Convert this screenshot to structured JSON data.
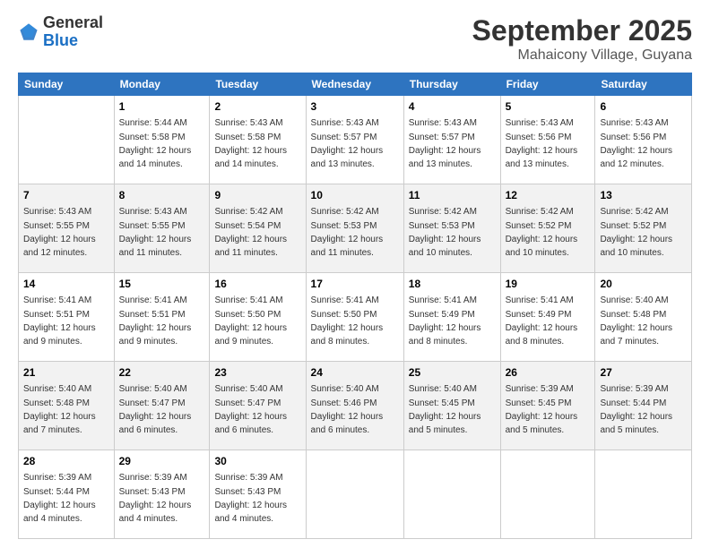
{
  "header": {
    "logo_general": "General",
    "logo_blue": "Blue",
    "month": "September 2025",
    "location": "Mahaicony Village, Guyana"
  },
  "weekdays": [
    "Sunday",
    "Monday",
    "Tuesday",
    "Wednesday",
    "Thursday",
    "Friday",
    "Saturday"
  ],
  "weeks": [
    [
      {
        "day": "",
        "sunrise": "",
        "sunset": "",
        "daylight": ""
      },
      {
        "day": "1",
        "sunrise": "Sunrise: 5:44 AM",
        "sunset": "Sunset: 5:58 PM",
        "daylight": "Daylight: 12 hours and 14 minutes."
      },
      {
        "day": "2",
        "sunrise": "Sunrise: 5:43 AM",
        "sunset": "Sunset: 5:58 PM",
        "daylight": "Daylight: 12 hours and 14 minutes."
      },
      {
        "day": "3",
        "sunrise": "Sunrise: 5:43 AM",
        "sunset": "Sunset: 5:57 PM",
        "daylight": "Daylight: 12 hours and 13 minutes."
      },
      {
        "day": "4",
        "sunrise": "Sunrise: 5:43 AM",
        "sunset": "Sunset: 5:57 PM",
        "daylight": "Daylight: 12 hours and 13 minutes."
      },
      {
        "day": "5",
        "sunrise": "Sunrise: 5:43 AM",
        "sunset": "Sunset: 5:56 PM",
        "daylight": "Daylight: 12 hours and 13 minutes."
      },
      {
        "day": "6",
        "sunrise": "Sunrise: 5:43 AM",
        "sunset": "Sunset: 5:56 PM",
        "daylight": "Daylight: 12 hours and 12 minutes."
      }
    ],
    [
      {
        "day": "7",
        "sunrise": "Sunrise: 5:43 AM",
        "sunset": "Sunset: 5:55 PM",
        "daylight": "Daylight: 12 hours and 12 minutes."
      },
      {
        "day": "8",
        "sunrise": "Sunrise: 5:43 AM",
        "sunset": "Sunset: 5:55 PM",
        "daylight": "Daylight: 12 hours and 11 minutes."
      },
      {
        "day": "9",
        "sunrise": "Sunrise: 5:42 AM",
        "sunset": "Sunset: 5:54 PM",
        "daylight": "Daylight: 12 hours and 11 minutes."
      },
      {
        "day": "10",
        "sunrise": "Sunrise: 5:42 AM",
        "sunset": "Sunset: 5:53 PM",
        "daylight": "Daylight: 12 hours and 11 minutes."
      },
      {
        "day": "11",
        "sunrise": "Sunrise: 5:42 AM",
        "sunset": "Sunset: 5:53 PM",
        "daylight": "Daylight: 12 hours and 10 minutes."
      },
      {
        "day": "12",
        "sunrise": "Sunrise: 5:42 AM",
        "sunset": "Sunset: 5:52 PM",
        "daylight": "Daylight: 12 hours and 10 minutes."
      },
      {
        "day": "13",
        "sunrise": "Sunrise: 5:42 AM",
        "sunset": "Sunset: 5:52 PM",
        "daylight": "Daylight: 12 hours and 10 minutes."
      }
    ],
    [
      {
        "day": "14",
        "sunrise": "Sunrise: 5:41 AM",
        "sunset": "Sunset: 5:51 PM",
        "daylight": "Daylight: 12 hours and 9 minutes."
      },
      {
        "day": "15",
        "sunrise": "Sunrise: 5:41 AM",
        "sunset": "Sunset: 5:51 PM",
        "daylight": "Daylight: 12 hours and 9 minutes."
      },
      {
        "day": "16",
        "sunrise": "Sunrise: 5:41 AM",
        "sunset": "Sunset: 5:50 PM",
        "daylight": "Daylight: 12 hours and 9 minutes."
      },
      {
        "day": "17",
        "sunrise": "Sunrise: 5:41 AM",
        "sunset": "Sunset: 5:50 PM",
        "daylight": "Daylight: 12 hours and 8 minutes."
      },
      {
        "day": "18",
        "sunrise": "Sunrise: 5:41 AM",
        "sunset": "Sunset: 5:49 PM",
        "daylight": "Daylight: 12 hours and 8 minutes."
      },
      {
        "day": "19",
        "sunrise": "Sunrise: 5:41 AM",
        "sunset": "Sunset: 5:49 PM",
        "daylight": "Daylight: 12 hours and 8 minutes."
      },
      {
        "day": "20",
        "sunrise": "Sunrise: 5:40 AM",
        "sunset": "Sunset: 5:48 PM",
        "daylight": "Daylight: 12 hours and 7 minutes."
      }
    ],
    [
      {
        "day": "21",
        "sunrise": "Sunrise: 5:40 AM",
        "sunset": "Sunset: 5:48 PM",
        "daylight": "Daylight: 12 hours and 7 minutes."
      },
      {
        "day": "22",
        "sunrise": "Sunrise: 5:40 AM",
        "sunset": "Sunset: 5:47 PM",
        "daylight": "Daylight: 12 hours and 6 minutes."
      },
      {
        "day": "23",
        "sunrise": "Sunrise: 5:40 AM",
        "sunset": "Sunset: 5:47 PM",
        "daylight": "Daylight: 12 hours and 6 minutes."
      },
      {
        "day": "24",
        "sunrise": "Sunrise: 5:40 AM",
        "sunset": "Sunset: 5:46 PM",
        "daylight": "Daylight: 12 hours and 6 minutes."
      },
      {
        "day": "25",
        "sunrise": "Sunrise: 5:40 AM",
        "sunset": "Sunset: 5:45 PM",
        "daylight": "Daylight: 12 hours and 5 minutes."
      },
      {
        "day": "26",
        "sunrise": "Sunrise: 5:39 AM",
        "sunset": "Sunset: 5:45 PM",
        "daylight": "Daylight: 12 hours and 5 minutes."
      },
      {
        "day": "27",
        "sunrise": "Sunrise: 5:39 AM",
        "sunset": "Sunset: 5:44 PM",
        "daylight": "Daylight: 12 hours and 5 minutes."
      }
    ],
    [
      {
        "day": "28",
        "sunrise": "Sunrise: 5:39 AM",
        "sunset": "Sunset: 5:44 PM",
        "daylight": "Daylight: 12 hours and 4 minutes."
      },
      {
        "day": "29",
        "sunrise": "Sunrise: 5:39 AM",
        "sunset": "Sunset: 5:43 PM",
        "daylight": "Daylight: 12 hours and 4 minutes."
      },
      {
        "day": "30",
        "sunrise": "Sunrise: 5:39 AM",
        "sunset": "Sunset: 5:43 PM",
        "daylight": "Daylight: 12 hours and 4 minutes."
      },
      {
        "day": "",
        "sunrise": "",
        "sunset": "",
        "daylight": ""
      },
      {
        "day": "",
        "sunrise": "",
        "sunset": "",
        "daylight": ""
      },
      {
        "day": "",
        "sunrise": "",
        "sunset": "",
        "daylight": ""
      },
      {
        "day": "",
        "sunrise": "",
        "sunset": "",
        "daylight": ""
      }
    ]
  ]
}
